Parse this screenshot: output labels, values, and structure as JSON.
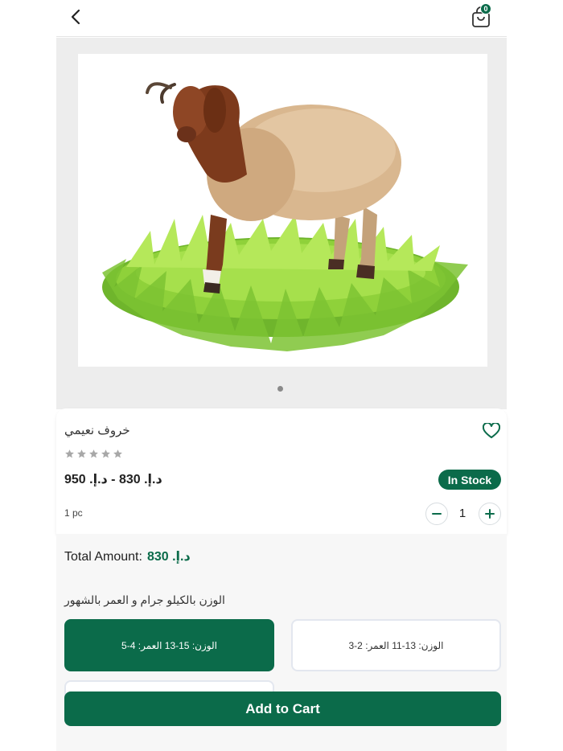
{
  "header": {
    "back_icon": "chevron-left-icon",
    "cart_icon": "shopping-bag-icon",
    "cart_count": "0"
  },
  "gallery": {
    "image_alt": "sheep",
    "page_count": 1,
    "active_page": 1
  },
  "product": {
    "name": "خروف نعيمي",
    "rating": 0,
    "rating_max": 5,
    "price": "د.إ. 830 - د.إ. 950",
    "stock_status": "In Stock",
    "unit": "1 pc",
    "quantity": "1"
  },
  "summary": {
    "total_label": "Total Amount:",
    "total_value": "د.إ. 830"
  },
  "variants": {
    "title": "الوزن بالكيلو جرام و العمر بالشهور",
    "options": [
      {
        "label": "الوزن: 15-13 العمر: 4-5",
        "selected": true
      },
      {
        "label": "الوزن: 13-11 العمر: 2-3",
        "selected": false
      }
    ]
  },
  "actions": {
    "add_to_cart": "Add to Cart"
  },
  "colors": {
    "brand": "#0b6b4a",
    "gallery_bg": "#ededed",
    "star_empty": "#a8a8a8"
  }
}
